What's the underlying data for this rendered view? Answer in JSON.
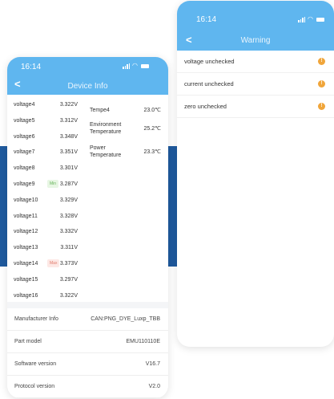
{
  "device_info": {
    "status_time": "16:14",
    "title": "Device Info",
    "voltages": [
      {
        "label": "voltage4",
        "value": "3.322V",
        "tag": ""
      },
      {
        "label": "voltage5",
        "value": "3.312V",
        "tag": ""
      },
      {
        "label": "voltage6",
        "value": "3.348V",
        "tag": ""
      },
      {
        "label": "voltage7",
        "value": "3.351V",
        "tag": ""
      },
      {
        "label": "voltage8",
        "value": "3.301V",
        "tag": ""
      },
      {
        "label": "voltage9",
        "value": "3.287V",
        "tag": "Min"
      },
      {
        "label": "voltage10",
        "value": "3.329V",
        "tag": ""
      },
      {
        "label": "voltage11",
        "value": "3.328V",
        "tag": ""
      },
      {
        "label": "voltage12",
        "value": "3.332V",
        "tag": ""
      },
      {
        "label": "voltage13",
        "value": "3.311V",
        "tag": ""
      },
      {
        "label": "voltage14",
        "value": "3.373V",
        "tag": "Max"
      },
      {
        "label": "voltage15",
        "value": "3.297V",
        "tag": ""
      },
      {
        "label": "voltage16",
        "value": "3.322V",
        "tag": ""
      }
    ],
    "temperatures": [
      {
        "label": "Tempe4",
        "value": "23.0℃"
      },
      {
        "label": "Environment Temperature",
        "value": "25.2℃"
      },
      {
        "label": "Power Temperature",
        "value": "23.3℃"
      }
    ],
    "info": [
      {
        "label": "Manufacturer Info",
        "value": "CAN:PNG_DYE_Luxp_TBB"
      },
      {
        "label": "Part model",
        "value": "EMU110110E"
      },
      {
        "label": "Software version",
        "value": "V16.7"
      },
      {
        "label": "Protocol version",
        "value": "V2.0"
      }
    ]
  },
  "warning": {
    "status_time": "16:14",
    "title": "Warning",
    "items": [
      {
        "label": "voltage unchecked",
        "badge": "!"
      },
      {
        "label": "current unchecked",
        "badge": "!"
      },
      {
        "label": "zero unchecked",
        "badge": "!"
      }
    ]
  },
  "colors": {
    "header": "#5fb6ef",
    "band": "#1f5a9e",
    "warning_badge": "#f0a53a"
  },
  "icons": {
    "back": "chevron-left-icon",
    "signal": "signal-icon",
    "wifi": "wifi-icon",
    "battery": "battery-icon"
  }
}
